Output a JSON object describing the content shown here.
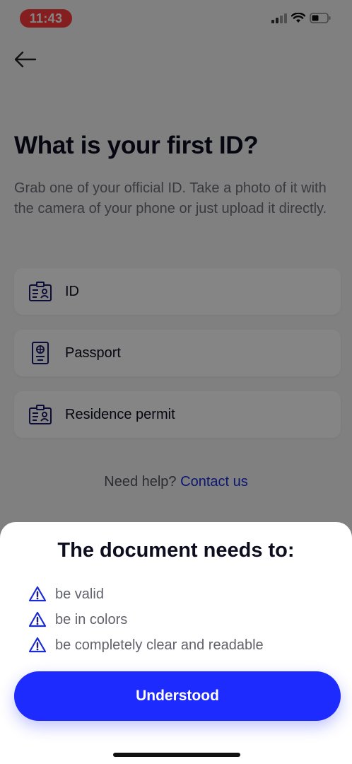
{
  "status_bar": {
    "time": "11:43"
  },
  "screen": {
    "title": "What is your first ID?",
    "subtitle": "Grab one of your official ID. Take a photo of it with the camera of your phone or just upload it directly.",
    "options": [
      {
        "label": "ID",
        "icon": "id-card-icon"
      },
      {
        "label": "Passport",
        "icon": "passport-icon"
      },
      {
        "label": "Residence permit",
        "icon": "id-card-icon"
      }
    ],
    "help_text": "Need help?",
    "help_link": "Contact us"
  },
  "sheet": {
    "title": "The document needs to:",
    "requirements": [
      "be valid",
      "be in colors",
      "be completely clear and readable"
    ],
    "button_label": "Understood"
  },
  "colors": {
    "accent": "#1e2bff",
    "link": "#1a2bd8",
    "time_pill": "#ff3b3b",
    "warning_icon": "#1a2bd8"
  }
}
